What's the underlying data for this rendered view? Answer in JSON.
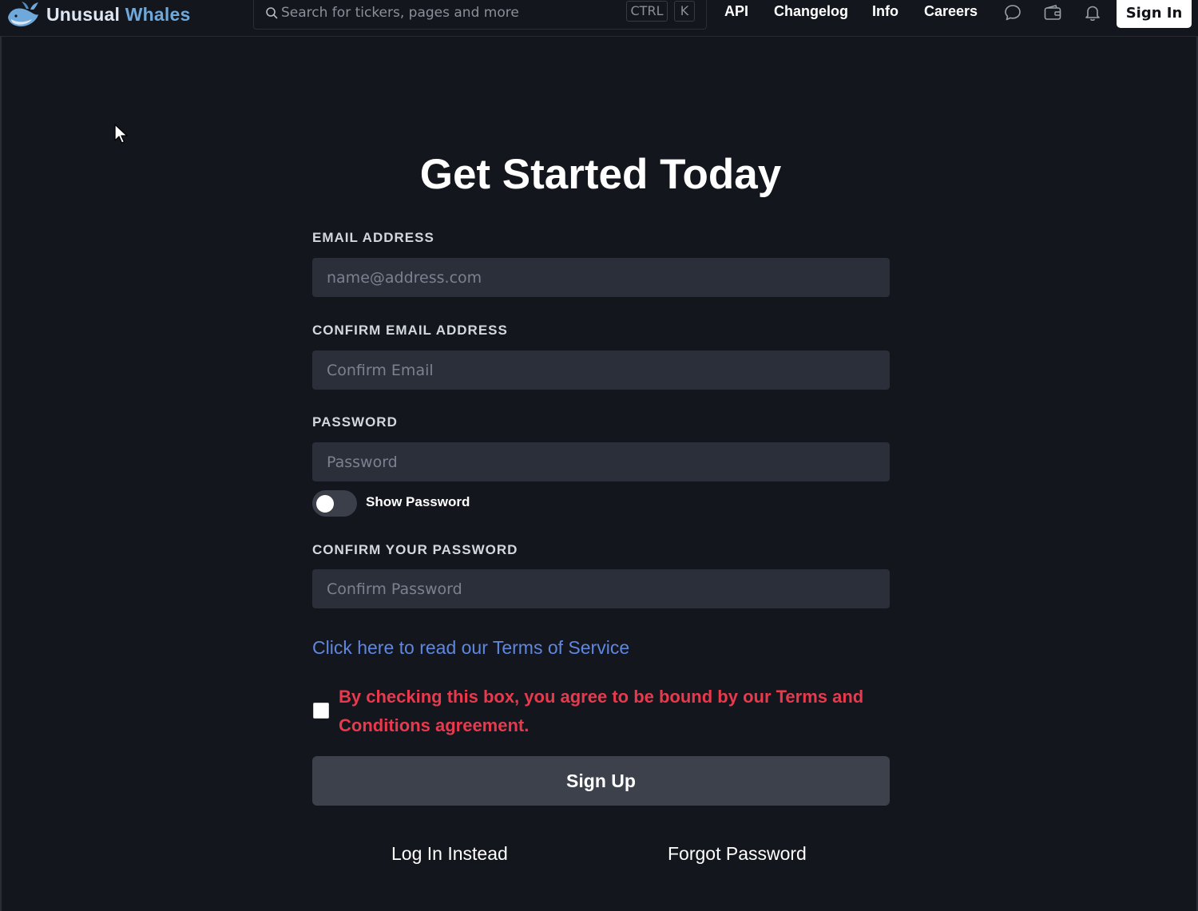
{
  "header": {
    "logo": {
      "word1": "Unusual",
      "word2": "Whales",
      "icon": "whale-logo-icon"
    },
    "search": {
      "placeholder": "Search for tickers, pages and more",
      "shortcut_ctrl": "CTRL",
      "shortcut_key": "K"
    },
    "nav": [
      "API",
      "Changelog",
      "Info",
      "Careers"
    ],
    "icons": [
      "chat-icon",
      "wallet-icon",
      "bell-icon"
    ],
    "sign_in_label": "Sign In"
  },
  "form": {
    "title": "Get Started Today",
    "email": {
      "label": "EMAIL ADDRESS",
      "placeholder": "name@address.com",
      "value": ""
    },
    "confirm_email": {
      "label": "CONFIRM EMAIL ADDRESS",
      "placeholder": "Confirm Email",
      "value": ""
    },
    "password": {
      "label": "PASSWORD",
      "placeholder": "Password",
      "value": ""
    },
    "show_password": {
      "label": "Show Password",
      "checked": false
    },
    "confirm_password": {
      "label": "CONFIRM YOUR PASSWORD",
      "placeholder": "Confirm Password",
      "value": ""
    },
    "tos_link": "Click here to read our Terms of Service",
    "agreement": {
      "text": "By checking this box, you agree to be bound by our Terms and Conditions agreement.",
      "checked": false
    },
    "sign_up_label": "Sign Up",
    "log_in_label": "Log In Instead",
    "forgot_label": "Forgot Password"
  },
  "colors": {
    "background": "#13161d",
    "input_bg": "#2b2f39",
    "link_blue": "#5f87e0",
    "agreement_red": "#e8394d",
    "logo_blue": "#6fa9db"
  }
}
